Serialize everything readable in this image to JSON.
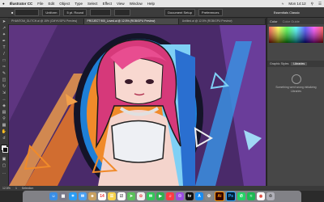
{
  "menubar": {
    "apple": "",
    "app_name": "Illustrator CC",
    "items": [
      "File",
      "Edit",
      "Object",
      "Type",
      "Select",
      "Effect",
      "View",
      "Window",
      "Help"
    ],
    "clock": "Mon 14:12"
  },
  "control_bar": {
    "stroke_preset": "Uniform",
    "brush": "5 pt. Round",
    "workspace_button": "Document Setup",
    "prefs_button": "Preferences"
  },
  "workspace": {
    "label": "Essentials Classic"
  },
  "tabs": [
    {
      "label": "PHANTOM_GLITCH.ai @ 15% (CMYK/GPU Preview)",
      "active": false
    },
    {
      "label": "PROJECT 900_Loved.ai @ 12.5% (RGB/GPU Preview)",
      "active": true
    },
    {
      "label": "Untitled.ai @ 12.5% (RGB/GPU Preview)",
      "active": false
    }
  ],
  "panels": {
    "color_tab": "Color",
    "color_guide_tab": "Color Guide",
    "graphic_styles_tab": "Graphic Styles",
    "libraries_tab": "Libraries",
    "libraries_message": "Something went wrong initializing Libraries"
  },
  "status": {
    "zoom": "12.5%",
    "page": "1",
    "tool": "Selection"
  },
  "dock": {
    "items": [
      "finder",
      "launchpad",
      "safari",
      "mail",
      "contacts",
      "calendar",
      "notes",
      "reminders",
      "maps",
      "photos",
      "messages",
      "facetime",
      "music",
      "podcasts",
      "tv",
      "app-store",
      "system-preferences",
      "illustrator",
      "photoshop",
      "whatsapp",
      "spotify",
      "chrome",
      "trash"
    ],
    "illustrator_label": "Ai",
    "photoshop_label": "Ps"
  },
  "colors": {
    "accent": "#e23a3a",
    "hair": "#d6397a",
    "ring_blue": "#1e7fd6",
    "bg_orange": "#f08a2a"
  }
}
